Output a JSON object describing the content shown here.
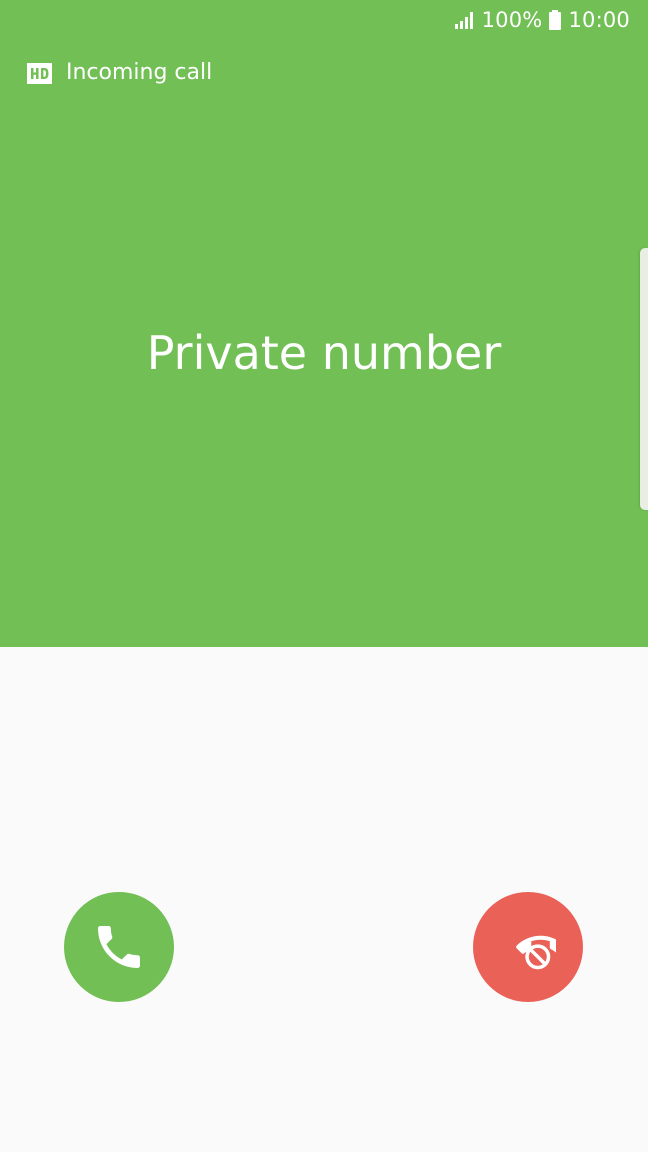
{
  "status_bar": {
    "battery": "100%",
    "time": "10:00",
    "signal_icon": "signal-icon",
    "battery_icon": "battery-icon"
  },
  "call": {
    "hd_icon": "hd-voice-icon",
    "status_label": "Incoming call",
    "caller": "Private number"
  },
  "actions": {
    "accept_icon": "phone-icon",
    "reject_icon": "phone-reject-icon"
  },
  "colors": {
    "accent_green": "#72BF56",
    "reject_red": "#EA6157",
    "background": "#FAFAFA"
  }
}
